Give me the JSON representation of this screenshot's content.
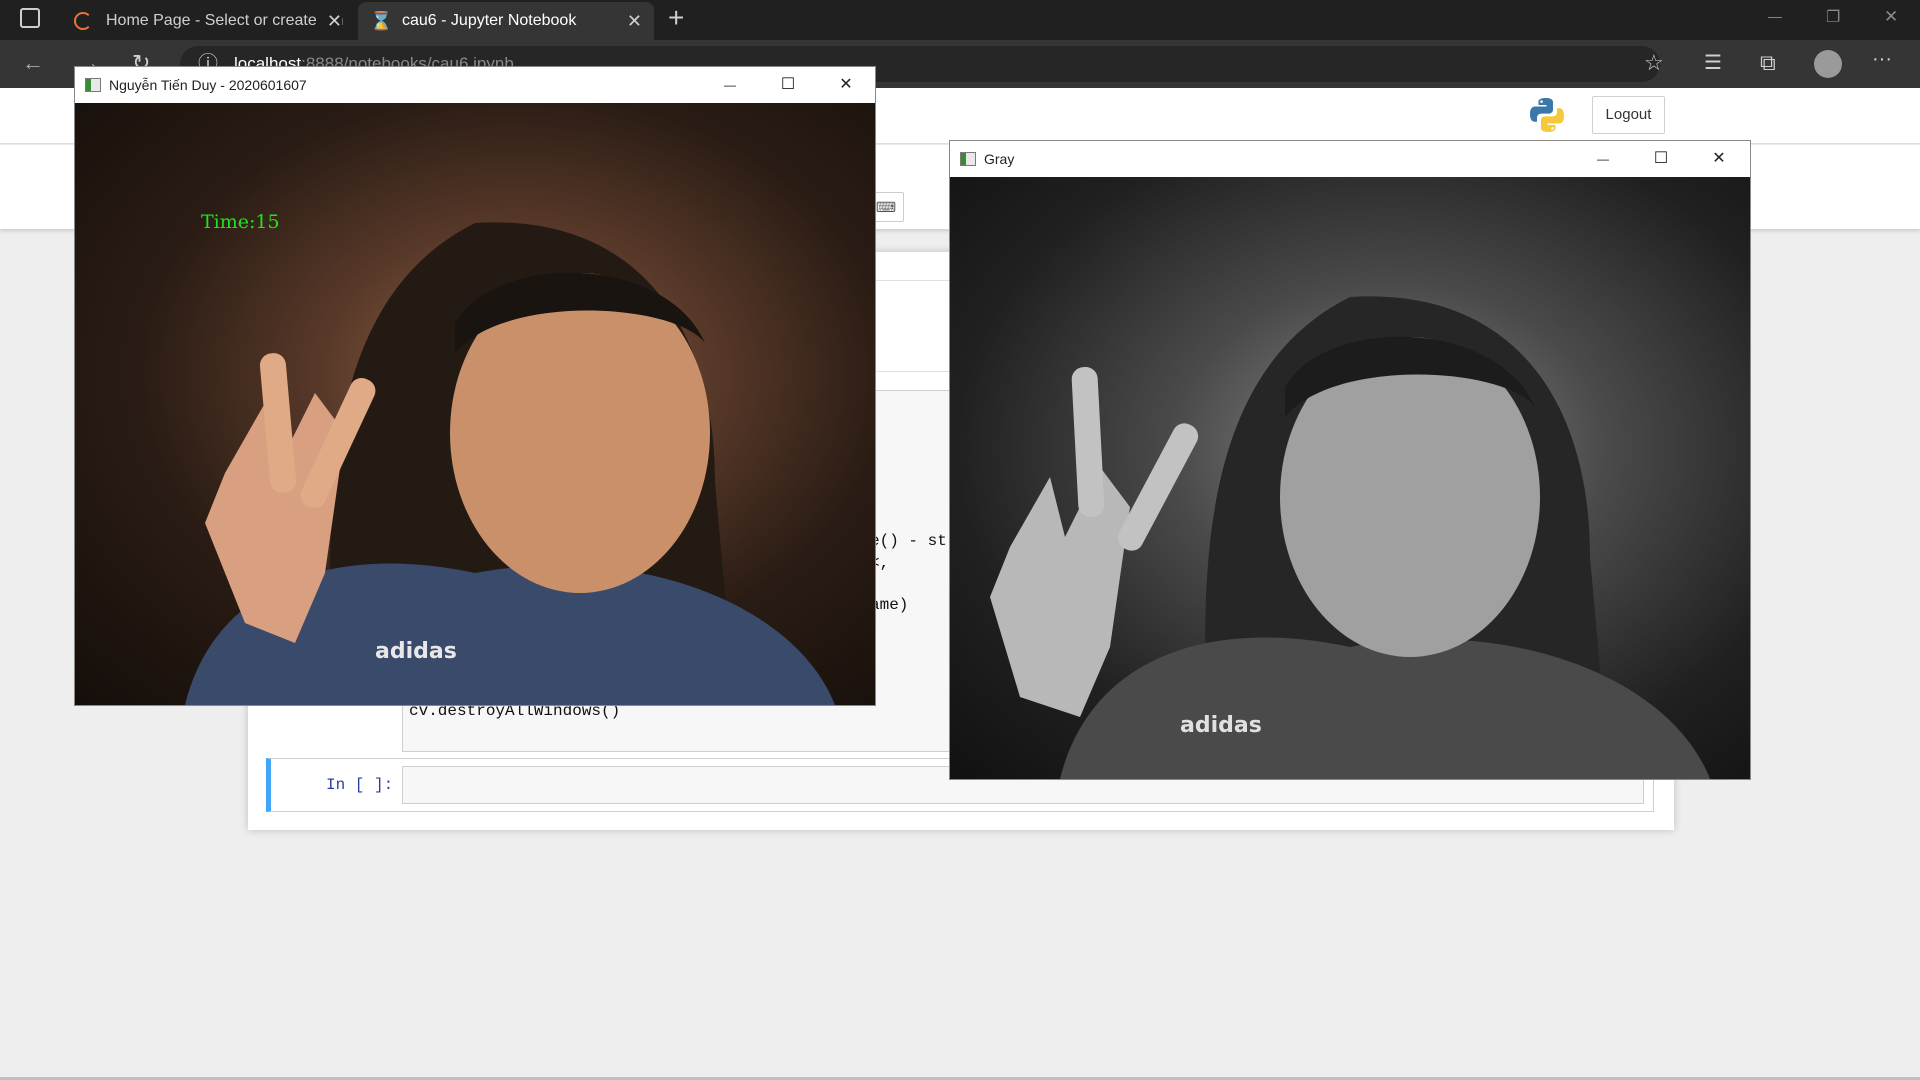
{
  "browser": {
    "tabs": [
      {
        "title": "Home Page - Select or create a n",
        "icon": "loading-spinner-icon",
        "close": "✕"
      },
      {
        "title": "cau6 - Jupyter Notebook",
        "icon": "hourglass-icon",
        "close": "✕"
      }
    ],
    "new_tab": "+",
    "url_host": "localhost",
    "url_path": ":8888/notebooks/cau6.ipynb",
    "window_controls": {
      "minimize": "—",
      "restore": "❐",
      "close": "✕"
    },
    "nav": {
      "back": "←",
      "forward": "→",
      "reload": "↻"
    },
    "info_glyph": "ⓘ",
    "right_icons": {
      "favorite_add": "☆",
      "favorites": "☰",
      "collections": "⧉",
      "more": "···"
    }
  },
  "jupyter": {
    "logout_label": "Logout",
    "keyboard_glyph": "⌨",
    "code_lines": [
      {
        "text": "e() - st",
        "y": 0
      },
      {
        "text": "<,",
        "y": 1
      },
      {
        "text": "ame)",
        "y": 2
      }
    ],
    "code_fragment_1": "e() - st",
    "code_fragment_2": "<,",
    "code_fragment_3": "ame)",
    "destroy_line": "cv.destroyAllWindows()",
    "in_prompt": "In [ ]:"
  },
  "cv_window_color": {
    "title": "Nguyễn Tiến Duy - 2020601607",
    "overlay_text": "Time:15",
    "controls": {
      "minimize": "—",
      "maximize": "☐",
      "close": "✕"
    }
  },
  "cv_window_gray": {
    "title": "Gray",
    "controls": {
      "minimize": "—",
      "maximize": "☐",
      "close": "✕"
    }
  },
  "colors": {
    "overlay_text": "#22e022",
    "cell_selected_border": "#42a5f5",
    "prompt": "#303f9f"
  }
}
